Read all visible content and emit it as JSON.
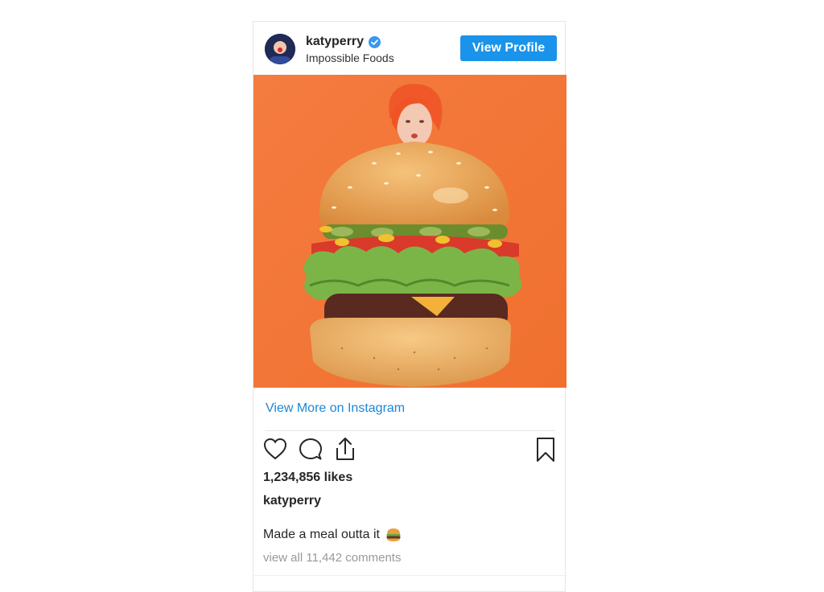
{
  "post": {
    "username": "katyperry",
    "subtitle": "Impossible Foods",
    "view_profile_label": "View Profile",
    "view_more_label": "View More on Instagram",
    "likes": "1,234,856 likes",
    "caption_user": "katyperry",
    "caption_text": "Made a meal outta it",
    "comments_link": "view all 11,442 comments"
  },
  "icons": {
    "verified": "verified-badge-icon",
    "like": "heart-icon",
    "comment": "comment-bubble-icon",
    "share": "share-icon",
    "save": "bookmark-icon",
    "caption_emoji": "hamburger-emoji-icon"
  },
  "colors": {
    "accent": "#1a93ea",
    "link": "#1b87d6",
    "photo_background": "#f27a3a",
    "hair": "#f05a28"
  }
}
